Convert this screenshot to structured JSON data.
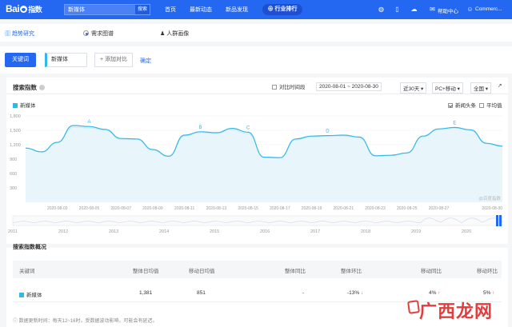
{
  "header": {
    "logo": "Bai 指数",
    "search_value": "新媒体",
    "search_button": "搜索",
    "nav": [
      "首页",
      "最新动态",
      "新品发现"
    ],
    "rank_button": "行业排行",
    "help": "帮助中心",
    "user": "Commerc..."
  },
  "subnav": {
    "trend": "趋势研究",
    "demand": "需求图谱",
    "portrait": "人群画像"
  },
  "keyword": {
    "label": "关键词",
    "value": "新媒体",
    "add": "+ 添加对比",
    "confirm": "确定"
  },
  "chart_panel": {
    "title": "搜索指数",
    "compare_period": "对比时间段",
    "date_range": "2020-08-01 ~ 2020-08-30",
    "period": "近30天",
    "device": "PC+移动",
    "region": "全国",
    "opt_news": "新闻头条",
    "opt_avg": "平均值",
    "watermark": "@百度指数"
  },
  "chart_data": {
    "type": "line",
    "series": [
      {
        "name": "新媒体",
        "values": [
          1130,
          1050,
          1250,
          1600,
          1580,
          1520,
          1330,
          1320,
          1100,
          960,
          1400,
          1470,
          1450,
          1540,
          1460,
          940,
          930,
          1320,
          1380,
          1390,
          1400,
          1360,
          970,
          980,
          1030,
          1380,
          1530,
          1560,
          1510,
          1230,
          1170
        ]
      },
      {
        "name": "",
        "values": [
          1130,
          1050,
          1250,
          1560,
          1550,
          1500,
          1310,
          1310,
          1080,
          950,
          1380,
          1450,
          1430,
          1510,
          1430,
          930,
          920,
          1300,
          1360,
          1380,
          1380,
          1340,
          960,
          970,
          1020,
          1360,
          1510,
          1540,
          1490,
          1220,
          1160
        ]
      }
    ],
    "x_labels": [
      "2020-08-03",
      "2020-08-05",
      "2020-08-07",
      "2020-08-09",
      "2020-08-11",
      "2020-08-13",
      "2020-08-15",
      "2020-08-17",
      "2020-08-19",
      "2020-08-21",
      "2020-08-23",
      "2020-08-25",
      "2020-08-27",
      "2020-08-30"
    ],
    "y_ticks": [
      300,
      600,
      900,
      1200,
      1500,
      1800
    ],
    "ylim": [
      0,
      1800
    ],
    "annotations": [
      {
        "label": "A",
        "day": 4
      },
      {
        "label": "B",
        "day": 11
      },
      {
        "label": "C",
        "day": 14
      },
      {
        "label": "D",
        "day": 19
      },
      {
        "label": "E",
        "day": 27
      }
    ],
    "year_labels": [
      "2011",
      "2012",
      "2013",
      "2014",
      "2015",
      "2016",
      "2017",
      "2018",
      "2019",
      "2020"
    ],
    "colors": {
      "line": "#34b7e8",
      "fill": "#e8f6fc",
      "line2": "#c6e9f7"
    }
  },
  "table": {
    "title": "搜索指数概况",
    "headers": [
      "关键词",
      "整体日均值",
      "移动日均值",
      "整体同比",
      "整体环比",
      "移动同比",
      "移动环比"
    ],
    "row": {
      "keyword": "新媒体",
      "overall_avg": "1,381",
      "mobile_avg": "851",
      "overall_yoy": "-",
      "overall_mom": "-13%",
      "mobile_yoy": "4%",
      "mobile_mom": "5%"
    },
    "footnote": "数据更新时间：每天12~16时，受数据波动影响，可能会有延迟。"
  },
  "watermark_text": "广西龙网"
}
